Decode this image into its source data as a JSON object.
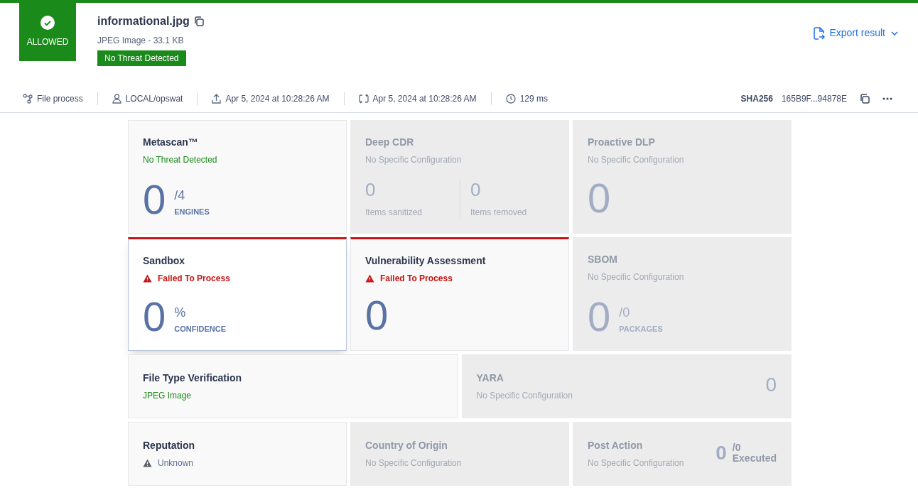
{
  "verdict": {
    "label": "ALLOWED",
    "allowed": true
  },
  "file": {
    "name": "informational.jpg",
    "details": "JPEG Image - 33.1 KB",
    "badge": "No Threat Detected"
  },
  "export_button": "Export result",
  "meta": [
    {
      "kind": "process",
      "text": "File process"
    },
    {
      "kind": "user",
      "text": "LOCAL/opswat"
    },
    {
      "kind": "upload",
      "text": "Apr 5, 2024 at 10:28:26 AM"
    },
    {
      "kind": "processed",
      "text": "Apr 5, 2024 at 10:28:26 AM"
    },
    {
      "kind": "time",
      "text": "129 ms"
    }
  ],
  "hash": {
    "label": "SHA256",
    "value": "165B9F...94878E"
  },
  "cards": [
    {
      "kind": "fraction",
      "title": "Metascan™",
      "status": "No Threat Detected",
      "failed": false,
      "warning": false,
      "enabled": true,
      "selected": false,
      "wide": false,
      "value": "0",
      "suffix": "/4",
      "caption": "ENGINES"
    },
    {
      "kind": "split",
      "title": "Deep CDR",
      "status": "No Specific Configuration",
      "failed": false,
      "warning": false,
      "enabled": false,
      "selected": false,
      "wide": false,
      "parts": [
        {
          "value": "0",
          "caption": "Items sanitized"
        },
        {
          "value": "0",
          "caption": "Items removed"
        }
      ]
    },
    {
      "kind": "big",
      "title": "Proactive DLP",
      "status": "No Specific Configuration",
      "failed": false,
      "warning": false,
      "enabled": false,
      "selected": false,
      "wide": false,
      "value": "0"
    },
    {
      "kind": "fraction",
      "title": "Sandbox",
      "status": "Failed To Process",
      "failed": true,
      "warning": false,
      "enabled": true,
      "selected": true,
      "wide": false,
      "value": "0",
      "suffix": "%",
      "caption": "CONFIDENCE"
    },
    {
      "kind": "big",
      "title": "Vulnerability Assessment",
      "status": "Failed To Process",
      "failed": true,
      "warning": false,
      "enabled": true,
      "selected": false,
      "wide": false,
      "value": "0"
    },
    {
      "kind": "fraction",
      "title": "SBOM",
      "status": "No Specific Configuration",
      "failed": false,
      "warning": false,
      "enabled": false,
      "selected": false,
      "wide": false,
      "value": "0",
      "suffix": "/0",
      "caption": "PACKAGES"
    },
    {
      "kind": "plain",
      "title": "File Type Verification",
      "status": "JPEG Image",
      "failed": false,
      "warning": false,
      "enabled": true,
      "selected": false,
      "wide": true
    },
    {
      "kind": "inline",
      "title": "YARA",
      "status": "No Specific Configuration",
      "failed": false,
      "warning": false,
      "enabled": false,
      "selected": false,
      "wide": true,
      "value": "0"
    },
    {
      "kind": "plain",
      "title": "Reputation",
      "status": "Unknown",
      "failed": false,
      "warning": true,
      "enabled": true,
      "selected": false,
      "wide": false
    },
    {
      "kind": "plain",
      "title": "Country of Origin",
      "status": "No Specific Configuration",
      "failed": false,
      "warning": false,
      "enabled": false,
      "selected": false,
      "wide": false
    },
    {
      "kind": "executed",
      "title": "Post Action",
      "status": "No Specific Configuration",
      "failed": false,
      "warning": false,
      "enabled": false,
      "selected": false,
      "wide": false,
      "value": "0",
      "suffix": "/0",
      "caption": "Executed"
    }
  ]
}
